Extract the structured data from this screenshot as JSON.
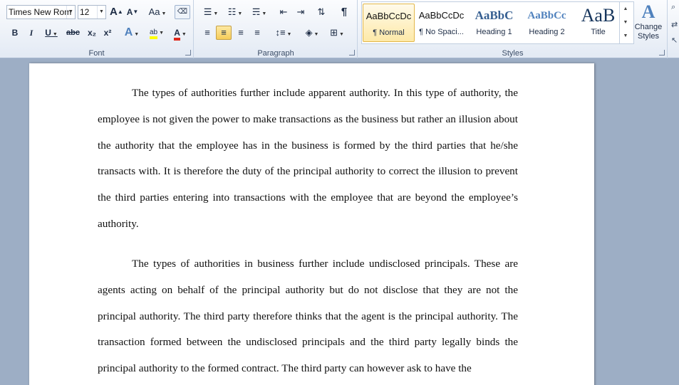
{
  "ribbon": {
    "font": {
      "name": "Times New Rom",
      "size": "12",
      "group_label": "Font"
    },
    "paragraph": {
      "group_label": "Paragraph"
    },
    "styles": {
      "group_label": "Styles",
      "items": [
        {
          "sample": "AaBbCcDc",
          "name": "¶ Normal"
        },
        {
          "sample": "AaBbCcDc",
          "name": "¶ No Spaci..."
        },
        {
          "sample": "AaBbC",
          "name": "Heading 1"
        },
        {
          "sample": "AaBbCc",
          "name": "Heading 2"
        },
        {
          "sample": "AaB",
          "name": "Title"
        }
      ],
      "change_styles": "Change Styles",
      "change_icon_glyph": "A"
    },
    "glyphs": {
      "grow_font": "A",
      "shrink_font": "A",
      "change_case": "Aa",
      "bold": "B",
      "italic": "I",
      "underline": "U",
      "strikethrough": "abc",
      "subscript": "x₂",
      "superscript": "x²",
      "text_effects": "A",
      "highlight": "ab",
      "font_color": "A",
      "show_marks": "¶"
    },
    "colors": {
      "highlight": "#ffff00",
      "font_color": "#e0281c",
      "text_effects": "#4f81bd",
      "accent": "#3b4d67"
    }
  },
  "document": {
    "paragraphs": [
      "The types of authorities further include apparent authority. In this type of authority, the employee is not given the power to make transactions as the business but rather an illusion about the authority that the employee has in the business is formed by the third parties that he/she transacts with. It is therefore the duty of the principal authority to correct the illusion to prevent the third parties entering into transactions with the employee that are beyond the employee’s authority.",
      "The types of authorities in business further include undisclosed principals. These are agents acting on behalf of the principal authority but do not disclose that they are not the principal authority. The third party therefore thinks that the agent is the principal authority. The transaction formed between the undisclosed principals and the third party legally binds the principal authority to the formed contract. The third party can however ask to have the"
    ]
  }
}
